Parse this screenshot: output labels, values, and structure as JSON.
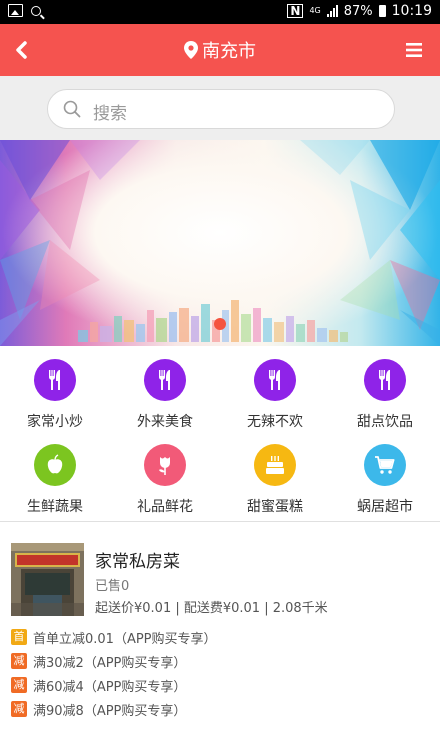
{
  "status": {
    "network": "4G",
    "battery": "87%",
    "time": "10:19"
  },
  "header": {
    "city": "南充市"
  },
  "search": {
    "placeholder": "搜索"
  },
  "categories": [
    {
      "label": "家常小炒",
      "color": "#8f23e8",
      "icon": "fork-knife-icon"
    },
    {
      "label": "外来美食",
      "color": "#8f23e8",
      "icon": "fork-knife-icon"
    },
    {
      "label": "无辣不欢",
      "color": "#8f23e8",
      "icon": "fork-knife-icon"
    },
    {
      "label": "甜点饮品",
      "color": "#8f23e8",
      "icon": "fork-knife-icon"
    },
    {
      "label": "生鲜蔬果",
      "color": "#7cc520",
      "icon": "apple-icon"
    },
    {
      "label": "礼品鲜花",
      "color": "#f25a78",
      "icon": "flower-icon"
    },
    {
      "label": "甜蜜蛋糕",
      "color": "#f6b812",
      "icon": "cake-icon"
    },
    {
      "label": "蜗居超市",
      "color": "#3cb8ea",
      "icon": "cart-icon"
    }
  ],
  "shop": {
    "name": "家常私房菜",
    "sold": "已售0",
    "fees": "起送价¥0.01 | 配送费¥0.01 | 2.08千米",
    "promos": [
      {
        "tag": "首",
        "color": "#f1a914",
        "text": "首单立减0.01（APP购买专享）"
      },
      {
        "tag": "减",
        "color": "#f06b25",
        "text": "满30减2（APP购买专享）"
      },
      {
        "tag": "减",
        "color": "#f06b25",
        "text": "满60减4（APP购买专享）"
      },
      {
        "tag": "减",
        "color": "#f06b25",
        "text": "满90减8（APP购买专享）"
      }
    ]
  }
}
